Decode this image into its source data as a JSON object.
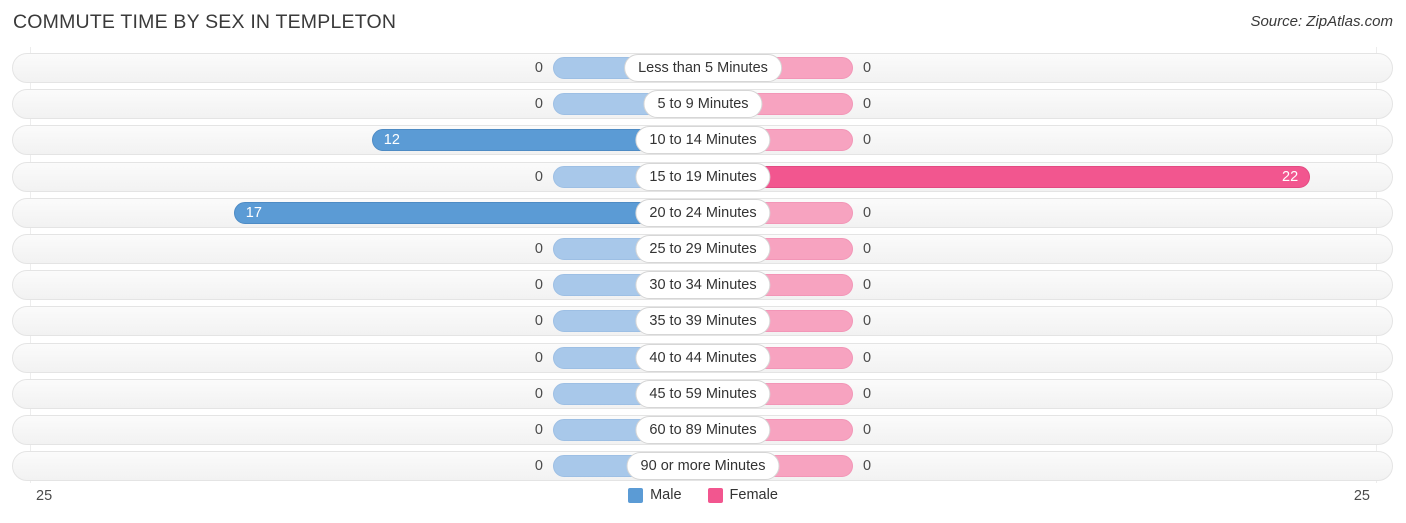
{
  "header": {
    "title": "COMMUTE TIME BY SEX IN TEMPLETON",
    "source": "Source: ZipAtlas.com"
  },
  "legend": {
    "male_label": "Male",
    "female_label": "Female",
    "male_color": "#5b9bd5",
    "female_color": "#f2568f"
  },
  "axis": {
    "left_end": "25",
    "right_end": "25"
  },
  "chart_data": {
    "type": "bar",
    "title": "COMMUTE TIME BY SEX IN TEMPLETON",
    "subtitle": "Source: ZipAtlas.com",
    "orientation": "horizontal-diverging",
    "xlabel": "",
    "ylabel": "",
    "xlim": [
      25,
      25
    ],
    "axis_max_per_side": 25,
    "grid": false,
    "legend_position": "bottom-center",
    "categories": [
      "Less than 5 Minutes",
      "5 to 9 Minutes",
      "10 to 14 Minutes",
      "15 to 19 Minutes",
      "20 to 24 Minutes",
      "25 to 29 Minutes",
      "30 to 34 Minutes",
      "35 to 39 Minutes",
      "40 to 44 Minutes",
      "45 to 59 Minutes",
      "60 to 89 Minutes",
      "90 or more Minutes"
    ],
    "series": [
      {
        "name": "Male",
        "color": "#5b9bd5",
        "side": "left",
        "values": [
          0,
          0,
          12,
          0,
          17,
          0,
          0,
          0,
          0,
          0,
          0,
          0
        ]
      },
      {
        "name": "Female",
        "color": "#f2568f",
        "side": "right",
        "values": [
          0,
          0,
          0,
          22,
          0,
          0,
          0,
          0,
          0,
          0,
          0,
          0
        ]
      }
    ],
    "value_labels": {
      "male": [
        "0",
        "0",
        "12",
        "0",
        "17",
        "0",
        "0",
        "0",
        "0",
        "0",
        "0",
        "0"
      ],
      "female": [
        "0",
        "0",
        "0",
        "22",
        "0",
        "0",
        "0",
        "0",
        "0",
        "0",
        "0",
        "0"
      ]
    }
  }
}
